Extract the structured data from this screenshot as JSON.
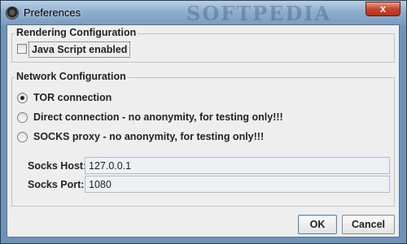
{
  "window": {
    "title": "Preferences",
    "watermark": "SOFTPEDIA",
    "close_label": "x"
  },
  "rendering": {
    "group_title": "Rendering Configuration",
    "javascript_label": "Java Script enabled",
    "javascript_checked": false
  },
  "network": {
    "group_title": "Network Configuration",
    "options": [
      {
        "label": "TOR connection",
        "selected": true
      },
      {
        "label": "Direct connection - no anonymity, for testing only!!!",
        "selected": false
      },
      {
        "label": "SOCKS proxy - no anonymity, for testing only!!!",
        "selected": false
      }
    ],
    "socks_host_label": "Socks Host:",
    "socks_host_value": "127.0.0.1",
    "socks_port_label": "Socks Port:",
    "socks_port_value": "1080"
  },
  "buttons": {
    "ok": "OK",
    "cancel": "Cancel"
  }
}
